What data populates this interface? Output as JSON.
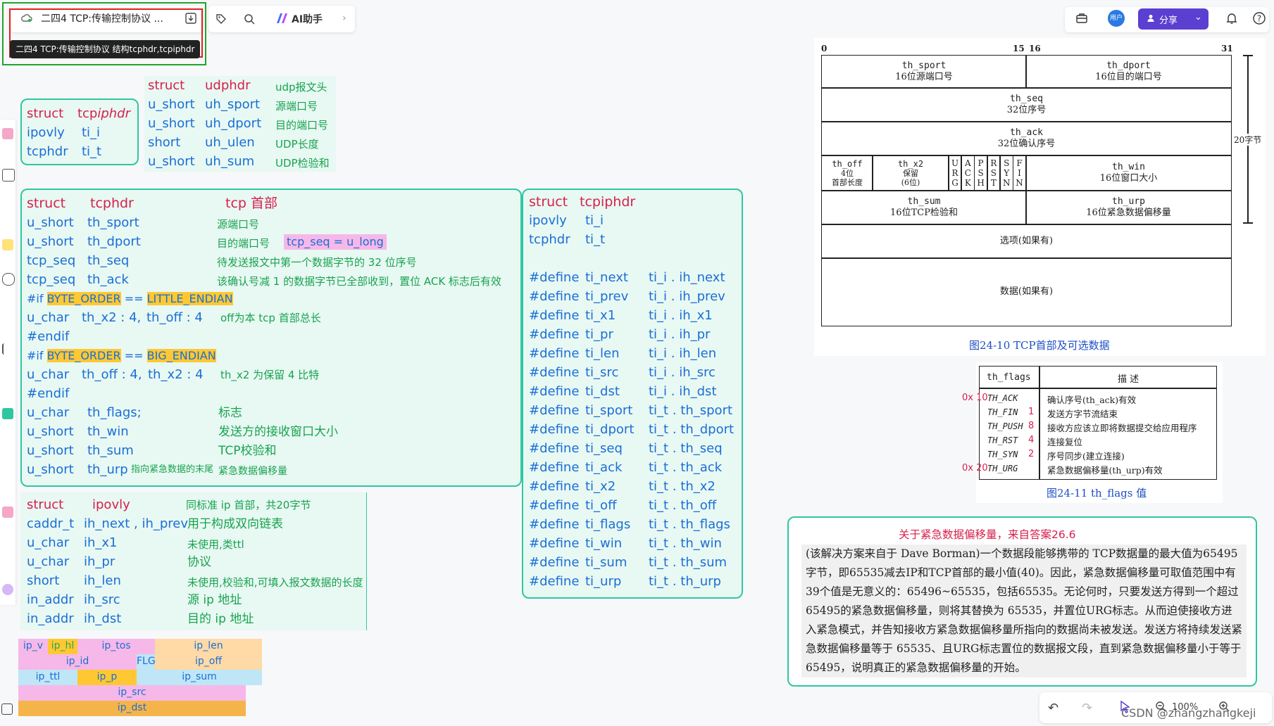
{
  "toolbar": {
    "doc_title": "二四4 TCP:传输控制协议 ...",
    "tooltip": "二四4 TCP:传输控制协议 结构tcphdr,tcpiphdr",
    "ai_label": "AI助手",
    "share_label": "分享",
    "user_label": "用户"
  },
  "tcpiphdr_small": {
    "l1": [
      "struct",
      "tcp",
      "iphdr"
    ],
    "l2": [
      "ipovly",
      "ti_i"
    ],
    "l3": [
      "tcphdr",
      "ti_t"
    ]
  },
  "udphdr": {
    "rows": [
      [
        "struct",
        "udphdr",
        "udp报文头"
      ],
      [
        "u_short",
        "uh_sport",
        "源端口号"
      ],
      [
        "u_short",
        "uh_dport",
        "目的端口号"
      ],
      [
        "short",
        "uh_ulen",
        "UDP长度"
      ],
      [
        "u_short",
        "uh_sum",
        "UDP检验和"
      ]
    ]
  },
  "tcphdr": {
    "title": [
      "struct",
      "tcphdr",
      "tcp 首部"
    ],
    "rows": [
      [
        "u_short",
        "th_sport",
        "源端口号"
      ],
      [
        "u_short",
        "th_dport",
        "目的端口号"
      ],
      [
        "tcp_seq",
        "th_seq",
        "待发送报文中第一个数据字节的 32 位序号"
      ],
      [
        "tcp_seq",
        "th_ack",
        "该确认号减 1 的数据字节已全部收到，置位 ACK 标志后有效"
      ]
    ],
    "seq_note": "tcp_seq = u_long",
    "if1": [
      "#if",
      "BYTE_ORDER",
      "==",
      "LITTLE_ENDIAN"
    ],
    "bits1": [
      "u_char",
      "th_x2 : 4,",
      "th_off : 4",
      "off为本 tcp 首部总长"
    ],
    "endif": "#endif",
    "if2": [
      "#if",
      "BYTE_ORDER",
      "==",
      "BIG_ENDIAN"
    ],
    "bits2": [
      "u_char",
      "th_off : 4,",
      "th_x2 : 4",
      "th_x2 为保留 4 比特"
    ],
    "rows2": [
      [
        "u_char",
        "th_flags;",
        "标志"
      ],
      [
        "u_short",
        "th_win",
        "发送方的接收窗口大小"
      ],
      [
        "u_short",
        "th_sum",
        "TCP校验和"
      ],
      [
        "u_short",
        "th_urp",
        "紧急数据偏移量"
      ]
    ],
    "urp_note": "指向紧急数据的末尾"
  },
  "ipovly": {
    "title": [
      "struct",
      "ipovly",
      "同标准 ip 首部，共20字节"
    ],
    "rows": [
      [
        "caddr_t",
        "ih_next , ih_prev",
        "用于构成双向链表"
      ],
      [
        "u_char",
        "ih_x1",
        "未使用,类ttl"
      ],
      [
        "u_char",
        "ih_pr",
        "协议"
      ],
      [
        "short",
        "ih_len",
        "未使用,校验和,可填入报文数据的长度"
      ],
      [
        "in_addr",
        "ih_src",
        "源 ip 地址"
      ],
      [
        "in_addr",
        "ih_dst",
        "目的 ip 地址"
      ]
    ]
  },
  "ip_layout": {
    "r1": [
      "ip_v",
      "ip_hl",
      "ip_tos",
      "ip_len"
    ],
    "r2": [
      "ip_id",
      "FLG",
      "ip_off"
    ],
    "r3": [
      "ip_ttl",
      "ip_p",
      "ip_sum"
    ],
    "r4": [
      "ip_src"
    ],
    "r5": [
      "ip_dst"
    ]
  },
  "tcpiphdr_big": {
    "title": [
      "struct",
      "tcpiphdr"
    ],
    "r1": [
      "ipovly",
      "ti_i"
    ],
    "r2": [
      "tcphdr",
      "ti_t"
    ],
    "defines": [
      [
        "#define",
        "ti_next",
        "ti_i . ih_next"
      ],
      [
        "#define",
        "ti_prev",
        "ti_i . ih_prev"
      ],
      [
        "#define",
        "ti_x1",
        "ti_i . ih_x1"
      ],
      [
        "#define",
        "ti_pr",
        "ti_i . ih_pr"
      ],
      [
        "#define",
        "ti_len",
        "ti_i . ih_len"
      ],
      [
        "#define",
        "ti_src",
        "ti_i . ih_src"
      ],
      [
        "#define",
        "ti_dst",
        "ti_i . ih_dst"
      ],
      [
        "#define",
        "ti_sport",
        "ti_t . th_sport"
      ],
      [
        "#define",
        "ti_dport",
        "ti_t . th_dport"
      ],
      [
        "#define",
        "ti_seq",
        "ti_t . th_seq"
      ],
      [
        "#define",
        "ti_ack",
        "ti_t . th_ack"
      ],
      [
        "#define",
        "ti_x2",
        "ti_t . th_x2"
      ],
      [
        "#define",
        "ti_off",
        "ti_t . th_off"
      ],
      [
        "#define",
        "ti_flags",
        "ti_t . th_flags"
      ],
      [
        "#define",
        "ti_win",
        "ti_t . th_win"
      ],
      [
        "#define",
        "ti_sum",
        "ti_t . th_sum"
      ],
      [
        "#define",
        "ti_urp",
        "ti_t . th_urp"
      ]
    ]
  },
  "figure": {
    "bits": [
      "0",
      "15",
      "16",
      "31"
    ],
    "sport": [
      "th_sport",
      "16位源端口号"
    ],
    "dport": [
      "th_dport",
      "16位目的端口号"
    ],
    "seq": [
      "th_seq",
      "32位序号"
    ],
    "ack": [
      "th_ack",
      "32位确认序号"
    ],
    "off": [
      "th_off",
      "4位",
      "首部长度"
    ],
    "x2": [
      "th_x2",
      "保留",
      "(6位)"
    ],
    "flag_letters": [
      "U\nR\nG",
      "A\nC\nK",
      "P\nS\nH",
      "R\nS\nT",
      "S\nY\nN",
      "F\nI\nN"
    ],
    "win": [
      "th_win",
      "16位窗口大小"
    ],
    "sum": [
      "th_sum",
      "16位TCP检验和"
    ],
    "urp": [
      "th_urp",
      "16位紧急数据偏移量"
    ],
    "options": "选项(如果有)",
    "data": "数据(如果有)",
    "bytes20": "20字节",
    "caption": "图24-10   TCP首部及可选数据"
  },
  "flags_table": {
    "head": [
      "th_flags",
      "描    述"
    ],
    "rows": [
      [
        "0x 10",
        "TH_ACK",
        "",
        "确认序号(th_ack)有效"
      ],
      [
        "",
        "TH_FIN",
        "1",
        "发送方字节流结束"
      ],
      [
        "",
        "TH_PUSH",
        "8",
        "接收方应该立即将数据提交给应用程序"
      ],
      [
        "",
        "TH_RST",
        "4",
        "连接复位"
      ],
      [
        "",
        "TH_SYN",
        "2",
        "序号同步(建立连接)"
      ],
      [
        "0x 20",
        "TH_URG",
        "",
        "紧急数据偏移量(th_urp)有效"
      ]
    ],
    "caption": "图24-11   th_flags  值"
  },
  "note": {
    "title": "关于紧急数据偏移量，来自答案26.6",
    "body": "(该解决方案来自于 Dave Borman)一个数据段能够携带的 TCP数据量的最大值为65495字节，即65535减去IP和TCP首部的最小值(40)。因此，紧急数据偏移量可取值范围中有39个值是无意义的：65496~65535，包括65535。无论何时，只要发送方得到一个超过65495的紧急数据偏移量，则将其替换为 65535，并置位URG标志。从而迫使接收方进入紧急模式，并告知接收方紧急数据偏移量所指向的数据尚未被发送。发送方将持续发送紧急数据偏移量等于 65535、且URG标志置位的数据报文段，直到紧急数据偏移量小于等于65495，说明真正的紧急数据偏移量的开始。"
  },
  "bottom": {
    "zoom": "100%",
    "watermark": "CSDN @zhangzhangkeji"
  }
}
